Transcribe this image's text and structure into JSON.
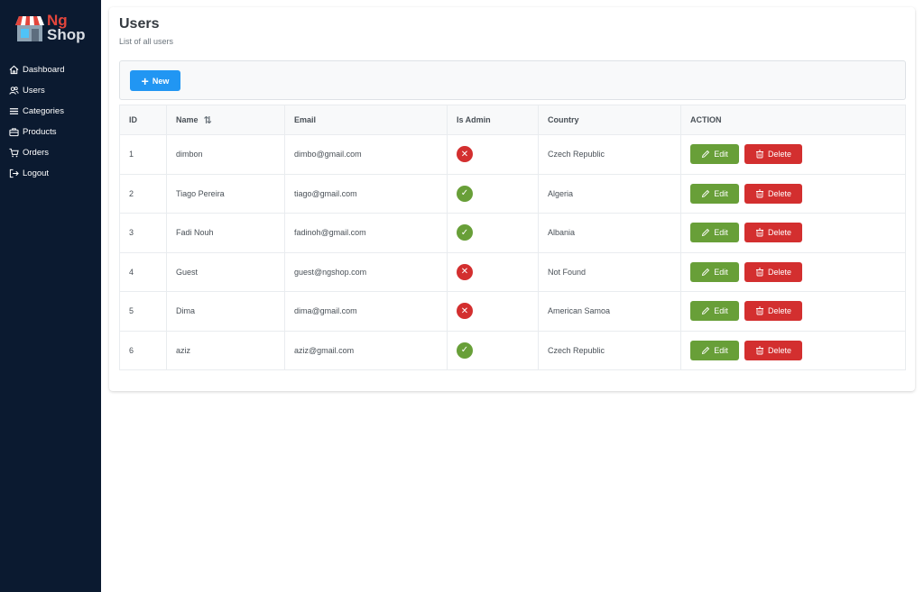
{
  "brand": {
    "line1": "Ng",
    "line2": "Shop"
  },
  "sidebar": {
    "items": [
      {
        "label": "Dashboard",
        "icon": "home-icon"
      },
      {
        "label": "Users",
        "icon": "users-icon"
      },
      {
        "label": "Categories",
        "icon": "list-icon"
      },
      {
        "label": "Products",
        "icon": "briefcase-icon"
      },
      {
        "label": "Orders",
        "icon": "cart-icon"
      },
      {
        "label": "Logout",
        "icon": "sign-out-icon"
      }
    ]
  },
  "header": {
    "title": "Users",
    "subtitle": "List of all users"
  },
  "toolbar": {
    "new_label": "New"
  },
  "table": {
    "columns": [
      "ID",
      "Name",
      "Email",
      "Is Admin",
      "Country",
      "ACTION"
    ],
    "rows": [
      {
        "id": "1",
        "name": "dimbon",
        "email": "dimbo@gmail.com",
        "is_admin": false,
        "country": "Czech Republic"
      },
      {
        "id": "2",
        "name": "Tiago Pereira",
        "email": "tiago@gmail.com",
        "is_admin": true,
        "country": "Algeria"
      },
      {
        "id": "3",
        "name": "Fadi Nouh",
        "email": "fadinoh@gmail.com",
        "is_admin": true,
        "country": "Albania"
      },
      {
        "id": "4",
        "name": "Guest",
        "email": "guest@ngshop.com",
        "is_admin": false,
        "country": "Not Found"
      },
      {
        "id": "5",
        "name": "Dima",
        "email": "dima@gmail.com",
        "is_admin": false,
        "country": "American Samoa"
      },
      {
        "id": "6",
        "name": "aziz",
        "email": "aziz@gmail.com",
        "is_admin": true,
        "country": "Czech Republic"
      }
    ],
    "edit_label": "Edit",
    "delete_label": "Delete"
  },
  "colors": {
    "sidebar": "#0b1a30",
    "primary": "#2196f3",
    "success": "#689f38",
    "danger": "#d32f2f"
  }
}
